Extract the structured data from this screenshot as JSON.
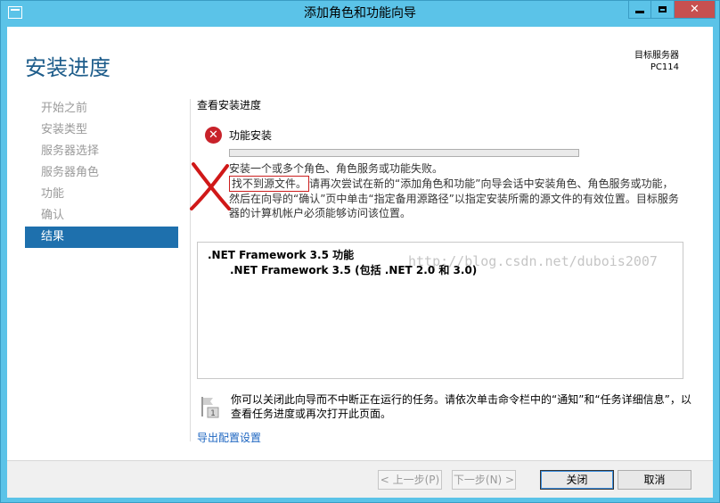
{
  "window": {
    "title": "添加角色和功能向导"
  },
  "header": {
    "page_title": "安装进度",
    "target_label": "目标服务器",
    "target_name": "PC114"
  },
  "nav": {
    "items": [
      {
        "label": "开始之前"
      },
      {
        "label": "安装类型"
      },
      {
        "label": "服务器选择"
      },
      {
        "label": "服务器角色"
      },
      {
        "label": "功能"
      },
      {
        "label": "确认"
      },
      {
        "label": "结果"
      }
    ]
  },
  "main": {
    "section_title": "查看安装进度",
    "feature_label": "功能安装",
    "progress_fraction": 0,
    "message_line1": "安装一个或多个角色、角色服务或功能失败。",
    "message_error": "找不到源文件。",
    "message_rest": "请再次尝试在新的“添加角色和功能”向导会话中安装角色、角色服务或功能，然后在向导的“确认”页中单击“指定备用源路径”以指定安装所需的源文件的有效位置。目标服务器的计算机帐户必须能够访问该位置。",
    "details": [
      ".NET Framework 3.5 功能",
      ".NET Framework 3.5 (包括 .NET 2.0 和 3.0)"
    ],
    "watermark": "http://blog.csdn.net/dubois2007",
    "info_text": "你可以关闭此向导而不中断正在运行的任务。请依次单击命令栏中的“通知”和“任务详细信息”，以查看任务进度或再次打开此页面。",
    "export_link": "导出配置设置"
  },
  "footer": {
    "prev_label": "< 上一步(P)",
    "next_label": "下一步(N) >",
    "close_label": "关闭",
    "cancel_label": "取消"
  },
  "colors": {
    "title_bar": "#5bc3e8",
    "heading": "#1e5d8b",
    "nav_active": "#1e70ad",
    "error": "#c8222a",
    "link": "#1e66c1"
  }
}
